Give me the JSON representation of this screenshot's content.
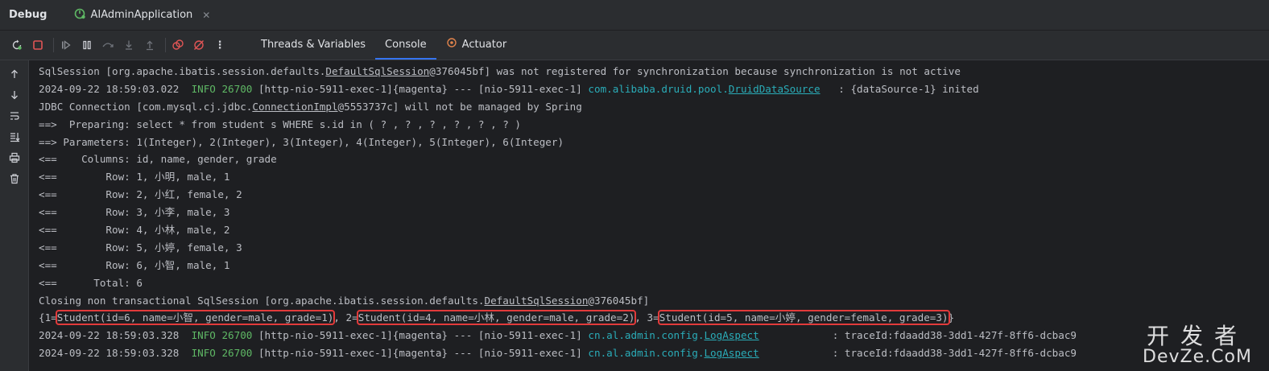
{
  "header": {
    "title": "Debug",
    "run_tab": {
      "icon": "spring-boot-icon",
      "label": "AIAdminApplication",
      "close": "✕"
    }
  },
  "toolbar": {
    "tabs": [
      {
        "label": "Threads & Variables"
      },
      {
        "label": "Console"
      },
      {
        "label": "Actuator",
        "icon": "actuator-icon"
      }
    ]
  },
  "console": {
    "l1": "SqlSession [org.apache.ibatis.session.defaults.",
    "l1u": "DefaultSqlSession",
    "l1b": "@376045bf] was not registered for synchronization because synchronization is not active",
    "l2ts": "2024-09-22 18:59:03.022  ",
    "l2lvl": "INFO 26700",
    "l2mid": " [http-nio-5911-exec-1]{magenta} --- [nio-5911-exec-1] ",
    "l2pkg": "com.alibaba.druid.pool.",
    "l2cls": "DruidDataSource",
    "l2end": "   : {dataSource-1} inited",
    "l3a": "JDBC Connection [com.mysql.cj.jdbc.",
    "l3u": "ConnectionImpl",
    "l3b": "@5553737c] will not be managed by Spring",
    "l4": "==>  Preparing: select * from student s WHERE s.id in ( ? , ? , ? , ? , ? , ? )",
    "l5": "==> Parameters: 1(Integer), 2(Integer), 3(Integer), 4(Integer), 5(Integer), 6(Integer)",
    "l6": "<==    Columns: id, name, gender, grade",
    "l7": "<==        Row: 1, 小明, male, 1",
    "l8": "<==        Row: 2, 小红, female, 2",
    "l9": "<==        Row: 3, 小李, male, 3",
    "l10": "<==        Row: 4, 小林, male, 2",
    "l11": "<==        Row: 5, 小婷, female, 3",
    "l12": "<==        Row: 6, 小智, male, 1",
    "l13": "<==      Total: 6",
    "l14a": "Closing non transactional SqlSession [org.apache.ibatis.session.defaults.",
    "l14u": "DefaultSqlSession",
    "l14b": "@376045bf]",
    "r_open": "{1=",
    "r1": "Student(id=6, name=小智, gender=male, grade=1)",
    "r_sep2": ", 2=",
    "r2": "Student(id=4, name=小林, gender=male, grade=2)",
    "r_sep3": ", 3=",
    "r3": "Student(id=5, name=小婷, gender=female, grade=3)",
    "r_close": "}",
    "l16ts": "2024-09-22 18:59:03.328  ",
    "l16lvl": "INFO 26700",
    "l16mid": " [http-nio-5911-exec-1]{magenta} --- [nio-5911-exec-1] ",
    "l16pkg": "cn.al.admin.config.",
    "l16cls": "LogAspect",
    "l16end": "            : traceId:fdaadd38-3dd1-427f-8ff6-dcbac9",
    "l17ts": "2024-09-22 18:59:03.328  ",
    "l17lvl": "INFO 26700",
    "l17mid": " [http-nio-5911-exec-1]{magenta} --- [nio-5911-exec-1] ",
    "l17pkg": "cn.al.admin.config.",
    "l17cls": "LogAspect",
    "l17end": "            : traceId:fdaadd38-3dd1-427f-8ff6-dcbac9"
  },
  "watermark": {
    "cn": "开发者",
    "en": "DevZe.CoM"
  },
  "colors": {
    "accent": "#3574f0",
    "info": "#5fb865",
    "link": "#2aacb8",
    "highlight": "#e23b3b"
  }
}
